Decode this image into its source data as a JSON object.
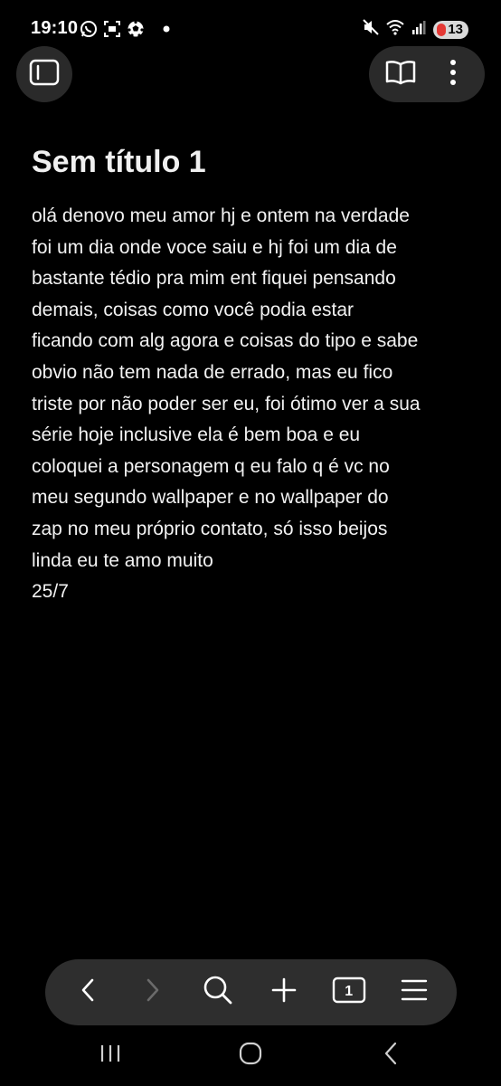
{
  "status_bar": {
    "time": "19:10",
    "battery_level": "13",
    "left_icons": [
      "whatsapp-icon",
      "screen-record-icon",
      "soccer-ball-icon",
      "dot-icon"
    ],
    "right_icons": [
      "mute-icon",
      "wifi-icon",
      "signal-icon",
      "battery-icon"
    ]
  },
  "toolbar": {
    "sidebar_icon": "sidebar-toggle-icon",
    "reader_icon": "book-icon",
    "menu_icon": "more-vertical-icon"
  },
  "note": {
    "title": "Sem título 1",
    "body": "olá denovo meu amor hj e ontem na verdade\nfoi um dia onde voce saiu e hj foi um dia de\nbastante tédio pra mim ent fiquei pensando\ndemais, coisas como você podia estar\nficando com alg agora e coisas do tipo e sabe\nobvio não tem nada de errado, mas eu fico\ntriste por não poder ser eu, foi ótimo ver a sua\nsérie hoje inclusive ela é bem boa e eu\ncoloquei a personagem q eu falo q é vc no\nmeu segundo wallpaper e no wallpaper do\nzap no meu próprio contato, só isso beijos\nlinda eu te amo muito\n25/7"
  },
  "bottom_bar": {
    "tab_count": "1",
    "icons": [
      "back-icon",
      "forward-icon",
      "search-icon",
      "add-icon",
      "tabs-icon",
      "menu-icon"
    ]
  },
  "nav_bar": {
    "icons": [
      "recents-icon",
      "home-icon",
      "system-back-icon"
    ]
  },
  "colors": {
    "background": "#000000",
    "toolbar": "#2e2e2e",
    "text": "#f2f2f2",
    "battery_low": "#e53935"
  }
}
